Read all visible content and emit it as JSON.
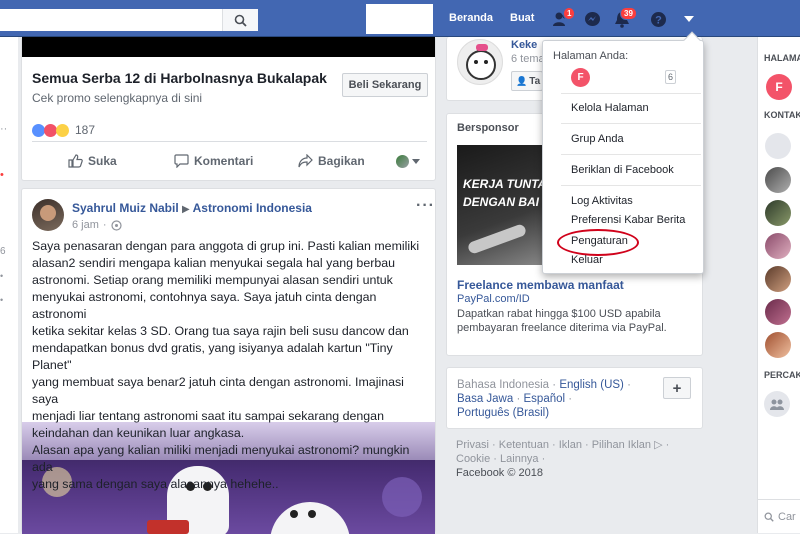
{
  "topbar": {
    "nav": [
      "Beranda",
      "Buat"
    ],
    "friend_badge": "1",
    "notif_badge": "39"
  },
  "ad": {
    "title": "Semua Serba 12 di Harbolnasnya Bukalapak",
    "subtitle": "Cek promo selengkapnya di sini",
    "cta": "Beli Sekarang",
    "reactions_count": "187",
    "actions": [
      "Suka",
      "Komentari",
      "Bagikan"
    ]
  },
  "post": {
    "author": "Syahrul Muiz Nabil",
    "group": "Astronomi Indonesia",
    "time": "6 jam",
    "text": [
      "Saya penasaran dengan para anggota di grup ini. Pasti kalian memiliki",
      "alasan2 sendiri mengapa kalian menyukai segala hal yang berbau",
      "astronomi. Setiap orang memiliki mempunyai alasan sendiri untuk",
      "menyukai astronomi, contohnya saya. Saya jatuh cinta dengan astronomi",
      "ketika sekitar kelas 3 SD. Orang tua saya rajin beli susu dancow dan",
      "mendapatkan bonus dvd gratis, yang isiyanya adalah kartun \"Tiny Planet\"",
      "yang membuat saya benar2 jatuh cinta dengan astronomi. Imajinasi saya",
      "menjadi liar tentang astronomi saat itu sampai sekarang dengan",
      "keindahan dan keunikan luar angkasa.",
      "Alasan apa yang kalian miliki menjadi menyukai astronomi? mungkin ada",
      "yang sama dengan saya alasannya hehehe.."
    ]
  },
  "profile_card": {
    "name": "Keke",
    "friends_partial": "6 tema",
    "button_partial": "Ta"
  },
  "sponsored": {
    "header": "Bersponsor",
    "image_text": [
      "KERJA TUNTA",
      "DENGAN BAI"
    ],
    "title": "Freelance membawa manfaat",
    "url": "PayPal.com/ID",
    "desc": "Dapatkan rabat hingga $100 USD apabila pembayaran freelance diterima via PayPal."
  },
  "languages": {
    "current": "Bahasa Indonesia",
    "options": [
      "English (US)",
      "Basa Jawa",
      "Español",
      "Português (Brasil)"
    ],
    "add": "+"
  },
  "footer": {
    "links_line1": "Privasi · Ketentuan · Iklan · Pilihan Iklan ▷ ·",
    "links_line2": "Cookie · Lainnya ·",
    "copyright": "Facebook © 2018"
  },
  "dropdown": {
    "header": "Halaman Anda:",
    "page_initial": "F",
    "page_count": "6",
    "items": [
      "Kelola Halaman",
      "Grup Anda",
      "Beriklan di Facebook",
      "Log Aktivitas",
      "Preferensi Kabar Berita",
      "Pengaturan",
      "Keluar"
    ],
    "highlight_color": "#d0021b"
  },
  "right_sidebar": {
    "pages_header": "HALAMA",
    "page_initial": "F",
    "contacts_header": "KONTAK",
    "groups_header": "PERCAK",
    "search_partial": "Car"
  },
  "left_strip_glyphs": [
    "··",
    "6",
    "•",
    "•",
    "•"
  ]
}
